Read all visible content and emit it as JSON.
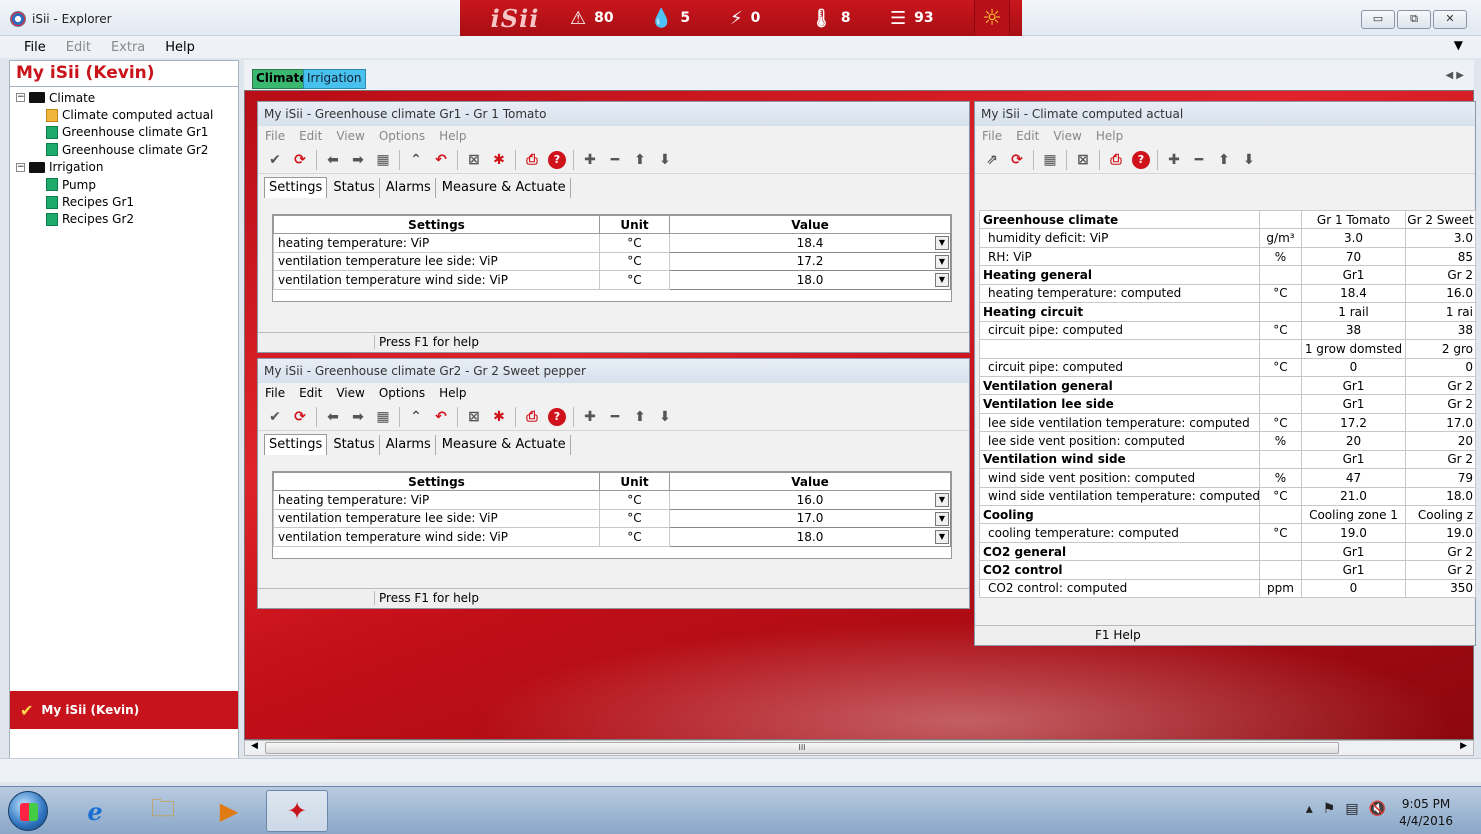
{
  "window": {
    "title": "iSii - Explorer"
  },
  "banner": {
    "logo": "iSii",
    "stats": [
      {
        "icon": "alarm-icon",
        "glyph": "⚠",
        "value": "80"
      },
      {
        "icon": "drop-icon",
        "glyph": "💧",
        "value": "5"
      },
      {
        "icon": "bolt-icon",
        "glyph": "⚡",
        "value": "0"
      },
      {
        "icon": "thermometer-icon",
        "glyph": "🌡",
        "value": "8"
      },
      {
        "icon": "list-icon",
        "glyph": "☰",
        "value": "93"
      }
    ],
    "sun_glyph": "☼"
  },
  "menubar": {
    "file": "File",
    "edit": "Edit",
    "extra": "Extra",
    "help": "Help"
  },
  "left": {
    "title": "My iSii (Kevin)",
    "tree": {
      "climate": "Climate",
      "climate_items": [
        "Climate computed actual",
        "Greenhouse climate Gr1",
        "Greenhouse climate Gr2"
      ],
      "irrigation": "Irrigation",
      "irrigation_items": [
        "Pump",
        "Recipes Gr1",
        "Recipes Gr2"
      ]
    },
    "footer": "My iSii (Kevin)"
  },
  "tabs": {
    "climate": "Climate",
    "irrigation": "Irrigation"
  },
  "win1": {
    "title": "My iSii - Greenhouse climate Gr1 - Gr 1 Tomato",
    "menu": [
      "File",
      "Edit",
      "View",
      "Options",
      "Help"
    ],
    "subtabs": [
      "Settings",
      "Status",
      "Alarms",
      "Measure & Actuate"
    ],
    "headers": [
      "Settings",
      "Unit",
      "Value"
    ],
    "rows": [
      {
        "name": "heating temperature: ViP",
        "unit": "°C",
        "value": "18.4"
      },
      {
        "name": "ventilation temperature lee side: ViP",
        "unit": "°C",
        "value": "17.2"
      },
      {
        "name": "ventilation temperature wind side: ViP",
        "unit": "°C",
        "value": "18.0"
      }
    ],
    "status": "Press F1 for help"
  },
  "win2": {
    "title": "My iSii - Greenhouse climate Gr2 - Gr 2 Sweet pepper",
    "menu": [
      "File",
      "Edit",
      "View",
      "Options",
      "Help"
    ],
    "subtabs": [
      "Settings",
      "Status",
      "Alarms",
      "Measure & Actuate"
    ],
    "headers": [
      "Settings",
      "Unit",
      "Value"
    ],
    "rows": [
      {
        "name": "heating temperature: ViP",
        "unit": "°C",
        "value": "16.0"
      },
      {
        "name": "ventilation temperature lee side: ViP",
        "unit": "°C",
        "value": "17.0"
      },
      {
        "name": "ventilation temperature wind side: ViP",
        "unit": "°C",
        "value": "18.0"
      }
    ],
    "status": "Press F1 for help"
  },
  "win3": {
    "title": "My iSii - Climate computed actual",
    "menu": [
      "File",
      "Edit",
      "View",
      "Help"
    ],
    "headers": [
      "Greenhouse climate",
      "",
      "Gr 1 Tomato",
      "Gr 2 Sweet"
    ],
    "rows": [
      {
        "name": "humidity deficit: ViP",
        "unit": "g/m³",
        "g1": "3.0",
        "g2": "3.0",
        "grp": false
      },
      {
        "name": "RH: ViP",
        "unit": "%",
        "g1": "70",
        "g2": "85",
        "grp": false
      },
      {
        "name": "Heating general",
        "unit": "",
        "g1": "Gr1",
        "g2": "Gr 2",
        "grp": true
      },
      {
        "name": "heating temperature: computed",
        "unit": "°C",
        "g1": "18.4",
        "g2": "16.0",
        "grp": false
      },
      {
        "name": "Heating circuit",
        "unit": "",
        "g1": "1 rail",
        "g2": "1 rai",
        "grp": true
      },
      {
        "name": "circuit pipe: computed",
        "unit": "°C",
        "g1": "38",
        "g2": "38",
        "grp": false
      },
      {
        "name": "",
        "unit": "",
        "g1": "1 grow domsted",
        "g2": "2 gro",
        "grp": false
      },
      {
        "name": "circuit pipe: computed",
        "unit": "°C",
        "g1": "0",
        "g2": "0",
        "grp": false
      },
      {
        "name": "Ventilation general",
        "unit": "",
        "g1": "Gr1",
        "g2": "Gr 2",
        "grp": true
      },
      {
        "name": "Ventilation lee side",
        "unit": "",
        "g1": "Gr1",
        "g2": "Gr 2",
        "grp": true
      },
      {
        "name": "lee side ventilation temperature: computed",
        "unit": "°C",
        "g1": "17.2",
        "g2": "17.0",
        "grp": false
      },
      {
        "name": "lee side vent position: computed",
        "unit": "%",
        "g1": "20",
        "g2": "20",
        "grp": false
      },
      {
        "name": "Ventilation wind side",
        "unit": "",
        "g1": "Gr1",
        "g2": "Gr 2",
        "grp": true
      },
      {
        "name": "wind side vent position: computed",
        "unit": "%",
        "g1": "47",
        "g2": "79",
        "grp": false
      },
      {
        "name": "wind side ventilation temperature: computed",
        "unit": "°C",
        "g1": "21.0",
        "g2": "18.0",
        "grp": false
      },
      {
        "name": "Cooling",
        "unit": "",
        "g1": "Cooling zone 1",
        "g2": "Cooling z",
        "grp": true
      },
      {
        "name": "cooling temperature: computed",
        "unit": "°C",
        "g1": "19.0",
        "g2": "19.0",
        "grp": false
      },
      {
        "name": "CO2 general",
        "unit": "",
        "g1": "Gr1",
        "g2": "Gr 2",
        "grp": true
      },
      {
        "name": "CO2 control",
        "unit": "",
        "g1": "Gr1",
        "g2": "Gr 2",
        "grp": true
      },
      {
        "name": "CO2 control: computed",
        "unit": "ppm",
        "g1": "0",
        "g2": "350",
        "grp": false
      }
    ],
    "status": "F1 Help"
  },
  "taskbar": {
    "time": "9:05 PM",
    "date": "4/4/2016"
  },
  "colors": {
    "brand_red": "#c9161d",
    "tab_green": "#3bb870",
    "tab_blue": "#49c1ee"
  }
}
